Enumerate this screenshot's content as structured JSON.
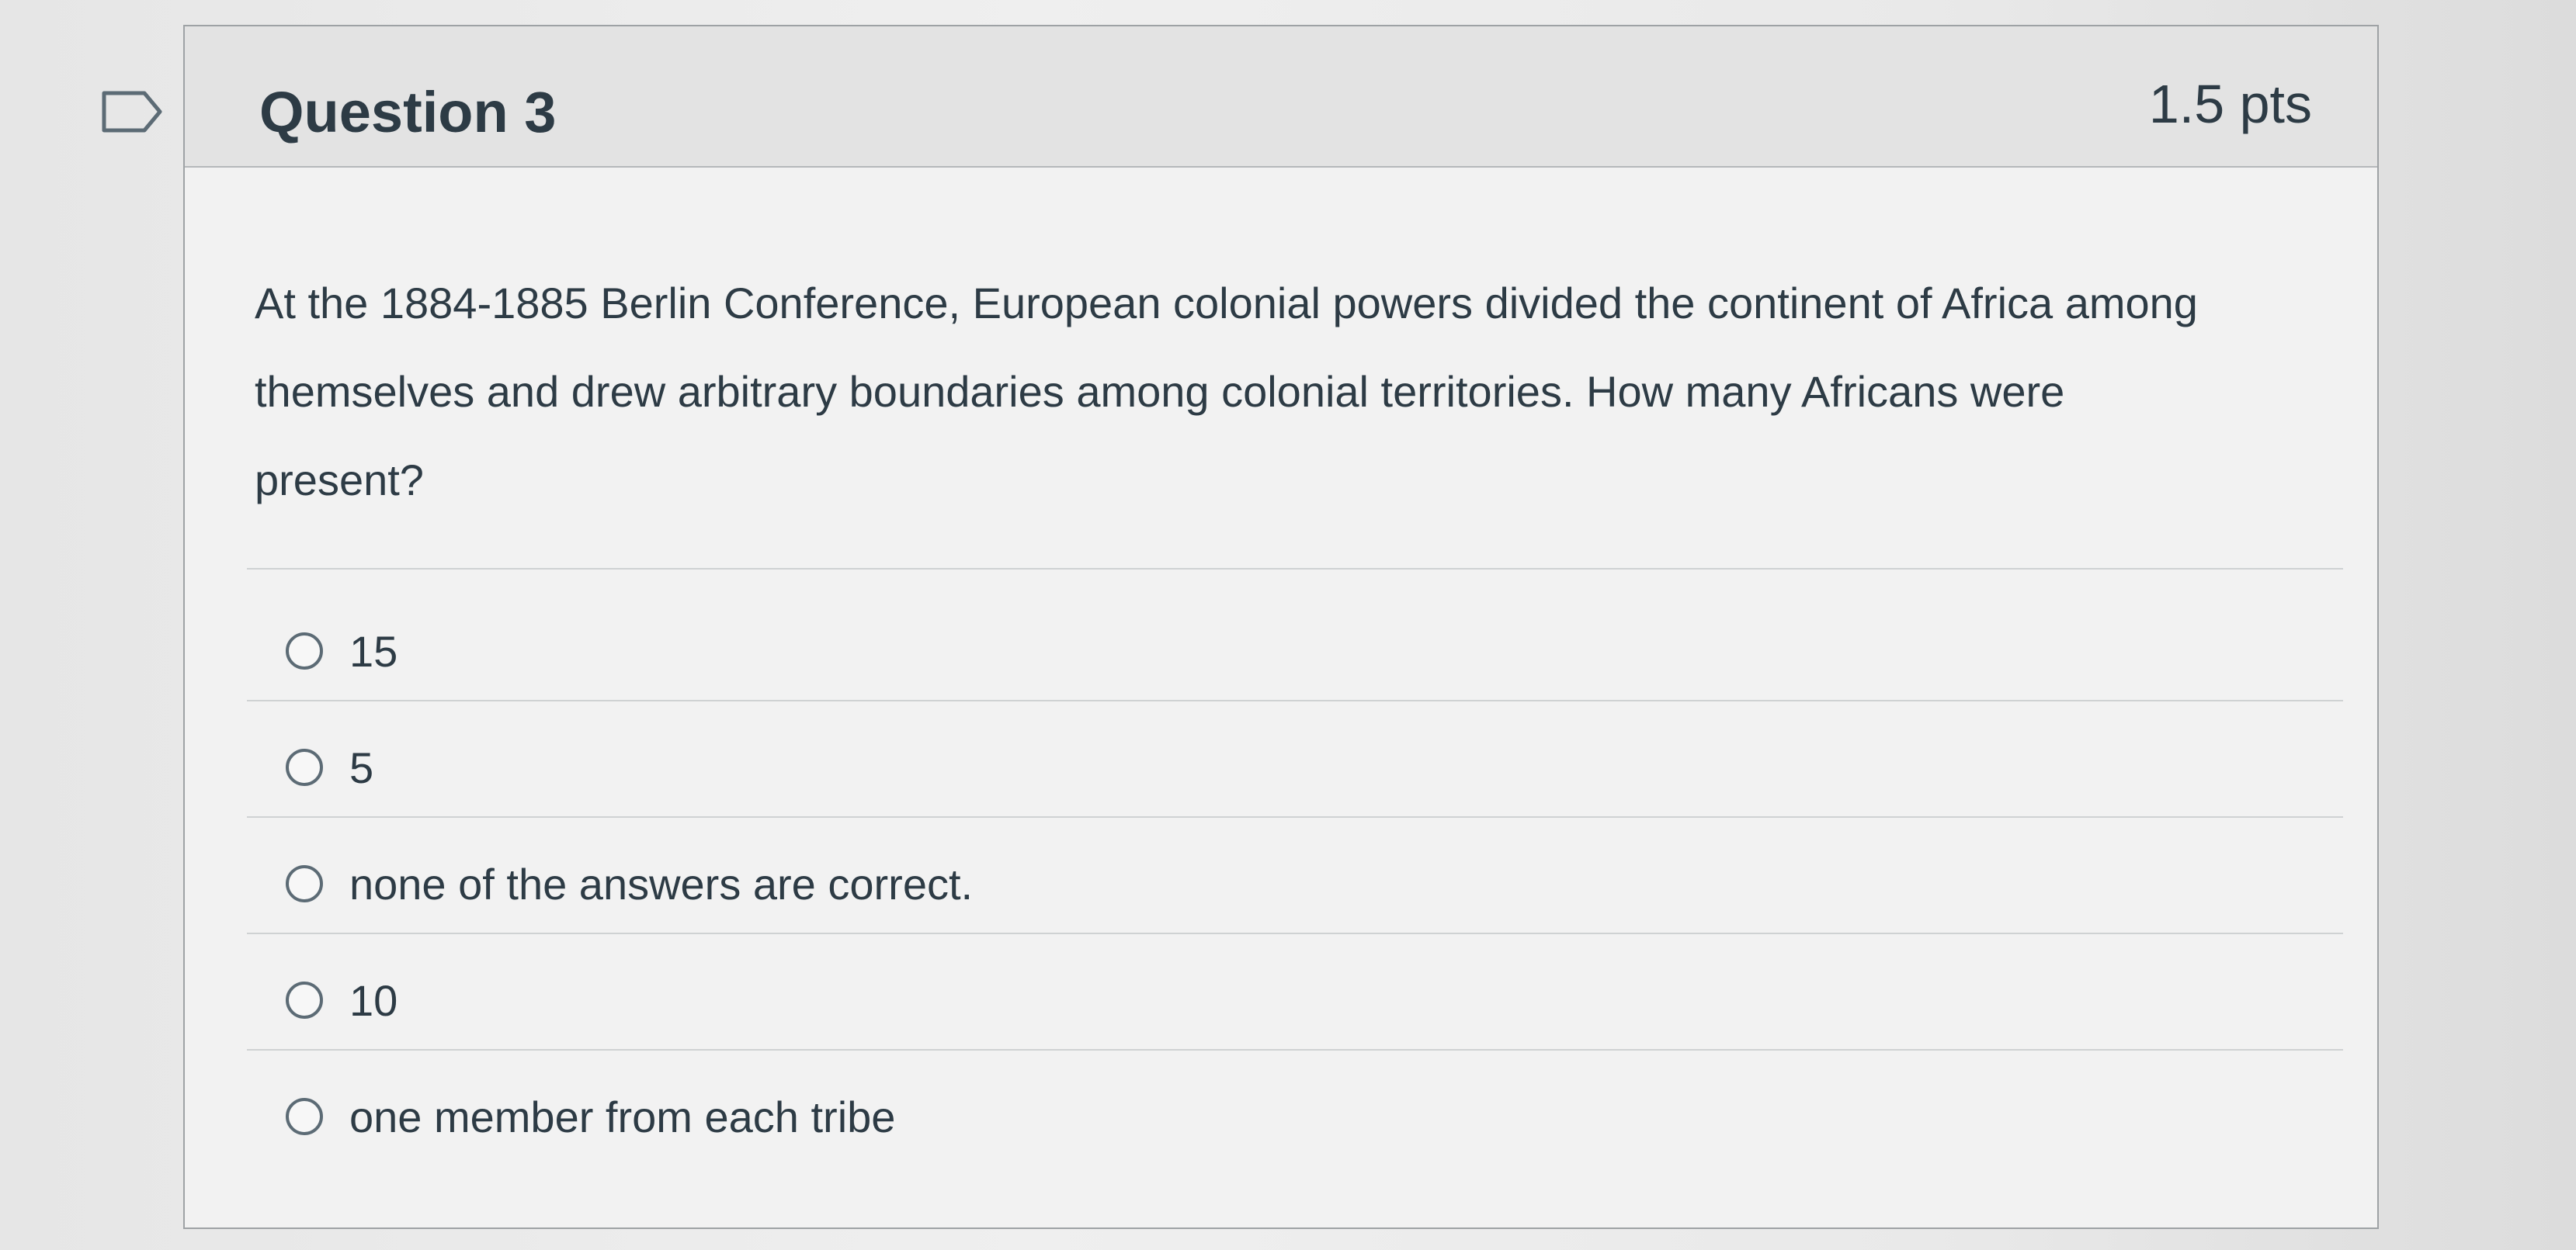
{
  "question": {
    "title": "Question 3",
    "points": "1.5 pts",
    "text": "At the 1884-1885 Berlin Conference, European colonial powers divided the continent of Africa among themselves and drew arbitrary boundaries among colonial territories. How many Africans were present?"
  },
  "answers": [
    {
      "label": "15"
    },
    {
      "label": "5"
    },
    {
      "label": "none of the answers are correct."
    },
    {
      "label": "10"
    },
    {
      "label": "one member from each tribe"
    }
  ],
  "icons": {
    "flag": "flag-question-icon",
    "radio": "radio-unselected-icon"
  },
  "colors": {
    "text": "#2d3b45",
    "header_bg": "#e3e3e3",
    "border": "#9ea2a5"
  }
}
